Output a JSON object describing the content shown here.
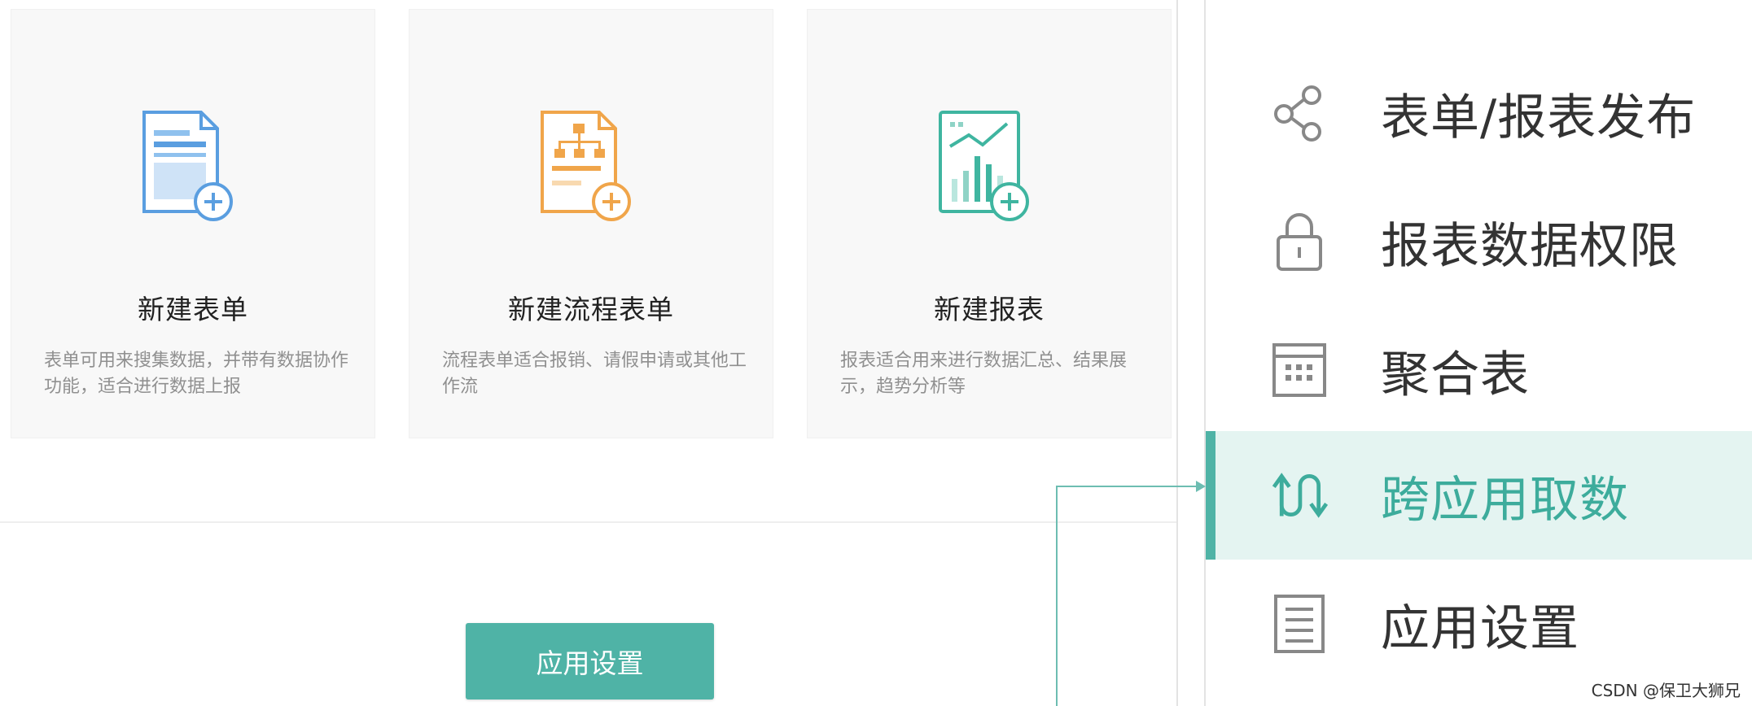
{
  "cards": [
    {
      "title": "新建表单",
      "description": "表单可用来搜集数据，并带有数据协作功能，适合进行数据上报",
      "icon": "new-form-icon",
      "color": "#4a90d9"
    },
    {
      "title": "新建流程表单",
      "description": "流程表单适合报销、请假申请或其他工作流",
      "icon": "new-workflow-form-icon",
      "color": "#f0a54a"
    },
    {
      "title": "新建报表",
      "description": "报表适合用来进行数据汇总、结果展示，趋势分析等",
      "icon": "new-report-icon",
      "color": "#3fb5a0"
    }
  ],
  "app_settings_button": "应用设置",
  "menu": {
    "accent_color": "#4fb3a6",
    "items": [
      {
        "label": "表单/报表发布",
        "icon": "share-icon",
        "active": false
      },
      {
        "label": "报表数据权限",
        "icon": "lock-icon",
        "active": false
      },
      {
        "label": "聚合表",
        "icon": "calendar-grid-icon",
        "active": false
      },
      {
        "label": "跨应用取数",
        "icon": "cross-app-fetch-icon",
        "active": true
      },
      {
        "label": "应用设置",
        "icon": "document-icon",
        "active": false
      }
    ]
  },
  "watermark": "CSDN @保卫大狮兄"
}
